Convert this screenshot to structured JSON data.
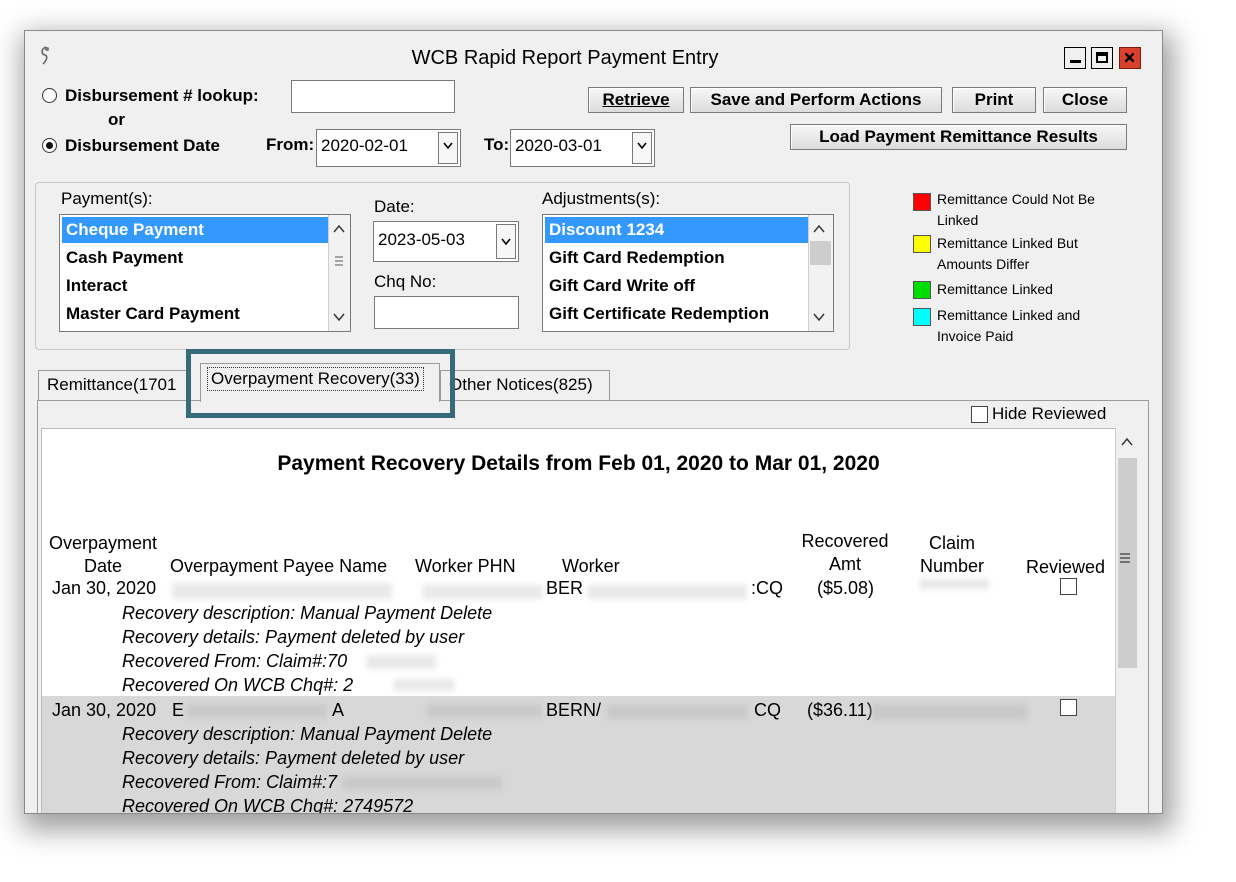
{
  "window": {
    "title": "WCB Rapid Report Payment Entry",
    "icons": [
      "app-icon",
      "minimize-icon",
      "maximize-icon",
      "close-icon"
    ],
    "close_color": "#d9412c"
  },
  "lookup": {
    "disb_lookup_label": "Disbursement # lookup:",
    "or_label": "or",
    "disb_date_label": "Disbursement Date",
    "lookup_value": "",
    "from_label": "From:",
    "from_value": "2020-02-01",
    "to_label": "To:",
    "to_value": "2020-03-01"
  },
  "toolbar": {
    "retrieve_label": "Retrieve",
    "save_label": "Save and Perform Actions",
    "print_label": "Print",
    "close_label": "Close",
    "load_label": "Load Payment Remittance Results"
  },
  "payments": {
    "label": "Payment(s):",
    "items": [
      "Cheque Payment",
      "Cash Payment",
      "Interact",
      "Master Card Payment"
    ],
    "selected_index": 0
  },
  "date_field": {
    "label": "Date:",
    "value": "2023-05-03",
    "chq_label": "Chq No:",
    "chq_value": ""
  },
  "adjustments": {
    "label": "Adjustments(s):",
    "items": [
      "Discount 1234",
      "Gift Card Redemption",
      "Gift Card Write off",
      "Gift Certificate Redemption"
    ],
    "selected_index": 0
  },
  "legend": [
    {
      "color": "#ff0000",
      "text": "Remittance Could Not Be Linked"
    },
    {
      "color": "#ffff00",
      "text": "Remittance Linked But Amounts Differ"
    },
    {
      "color": "#00dd00",
      "text": "Remittance Linked"
    },
    {
      "color": "#00ffff",
      "text": "Remittance Linked and Invoice Paid"
    }
  ],
  "tabs": [
    "Remittance(1701",
    "Overpayment Recovery(33)",
    "Other Notices(825)"
  ],
  "active_tab": 1,
  "hide_reviewed_label": "Hide Reviewed",
  "report": {
    "title": "Payment Recovery Details from Feb 01, 2020 to Mar 01, 2020",
    "headers": {
      "overpayment_date": "Overpayment Date",
      "payee_name": "Overpayment Payee Name",
      "worker_phn": "Worker PHN",
      "worker": "Worker",
      "recovered_amt": "Recovered Amt",
      "claim_number": "Claim Number",
      "reviewed": "Reviewed"
    },
    "rows": [
      {
        "date": "Jan 30, 2020",
        "payee": "",
        "worker": "BER",
        "type": ":CQ",
        "amount": "($5.08)",
        "desc1": "Recovery description: Manual Payment Delete",
        "desc2": "Recovery details: Payment deleted by user",
        "desc3": "Recovered From: Claim#:70",
        "desc4": "Recovered On WCB Chq#: 2"
      },
      {
        "date": "Jan 30, 2020",
        "payee": "E",
        "payee_tail": "A",
        "worker": "BERN/",
        "type": "CQ",
        "amount": "($36.11)",
        "desc1": "Recovery description: Manual Payment Delete",
        "desc2": "Recovery details: Payment deleted by user",
        "desc3": "Recovered From: Claim#:7",
        "desc4": "Recovered On WCB Chq#: 2749572"
      }
    ]
  },
  "highlight_color": "#366b7b"
}
